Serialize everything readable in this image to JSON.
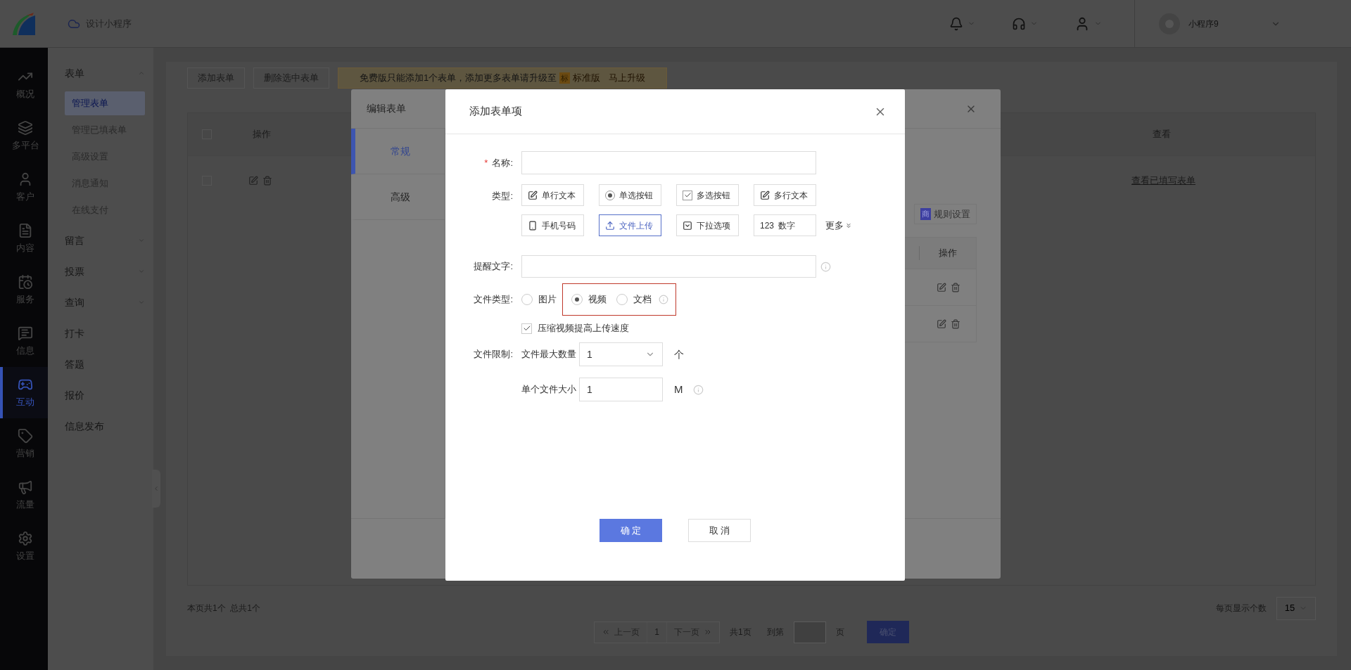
{
  "header": {
    "app_title": "设计小程序",
    "username": "小程序9"
  },
  "rail": [
    {
      "label": "概况",
      "selected": false
    },
    {
      "label": "多平台",
      "selected": false
    },
    {
      "label": "客户",
      "selected": false
    },
    {
      "label": "内容",
      "selected": false
    },
    {
      "label": "服务",
      "selected": false
    },
    {
      "label": "信息",
      "selected": false
    },
    {
      "label": "互动",
      "selected": true
    },
    {
      "label": "营销",
      "selected": false
    },
    {
      "label": "流量",
      "selected": false
    },
    {
      "label": "设置",
      "selected": false
    }
  ],
  "sidebar": [
    {
      "kind": "group",
      "label": "表单",
      "expanded": true,
      "children": [
        {
          "label": "管理表单",
          "selected": true
        },
        {
          "label": "管理已填表单",
          "selected": false
        },
        {
          "label": "高级设置",
          "selected": false
        },
        {
          "label": "消息通知",
          "selected": false
        },
        {
          "label": "在线支付",
          "selected": false
        }
      ]
    },
    {
      "kind": "group",
      "label": "留言",
      "expanded": false
    },
    {
      "kind": "group",
      "label": "投票",
      "expanded": false
    },
    {
      "kind": "group",
      "label": "查询",
      "expanded": false
    },
    {
      "kind": "link",
      "label": "打卡"
    },
    {
      "kind": "link",
      "label": "答题"
    },
    {
      "kind": "link",
      "label": "报价"
    },
    {
      "kind": "link",
      "label": "信息发布"
    }
  ],
  "page": {
    "toolbar": [
      "添加表单",
      "删除选中表单"
    ],
    "banner": {
      "text": "免费版只能添加1个表单，添加更多表单请升级至",
      "badge": "标",
      "edition": "标准版",
      "upgrade": "马上升级"
    },
    "table": {
      "select_all": {
        "checked": false
      },
      "columns": [
        "操作",
        "查看"
      ],
      "rows": [
        {
          "checked": false,
          "link": "查看已填写表单"
        }
      ]
    },
    "summary": "本页共1个  总共1个",
    "pagination": {
      "prev": "上一页",
      "page": "1",
      "next": "下一页",
      "total": "共1页",
      "goto": "到第",
      "unit": "页",
      "confirm": "确定"
    },
    "page_size": {
      "label": "每页显示个数",
      "value": "15"
    }
  },
  "edit_dialog": {
    "title": "编辑表单",
    "tabs": [
      {
        "label": "常规",
        "selected": true
      },
      {
        "label": "高级",
        "selected": false
      }
    ],
    "rule_button": {
      "badge": "商",
      "label": "规则设置"
    },
    "table": {
      "column": "操作",
      "rows": [
        {
          "kind": "edit-delete"
        },
        {
          "kind": "edit-delete"
        }
      ]
    }
  },
  "add_dialog": {
    "title": "添加表单项",
    "name": {
      "label": "名称:",
      "required_mark": "*"
    },
    "type": {
      "label": "类型:",
      "options": [
        {
          "label": "单行文本",
          "selected": false
        },
        {
          "label": "单选按钮",
          "selected": false
        },
        {
          "label": "多选按钮",
          "selected": false
        },
        {
          "label": "多行文本",
          "selected": false
        },
        {
          "label": "手机号码",
          "selected": false
        },
        {
          "label": "文件上传",
          "selected": true
        },
        {
          "label": "下拉选项",
          "selected": false
        },
        {
          "label": "数字",
          "prefix": "123",
          "selected": false
        }
      ],
      "more": "更多"
    },
    "hint": {
      "label": "提醒文字:"
    },
    "file_type": {
      "label": "文件类型:",
      "options": [
        {
          "label": "图片",
          "selected": false,
          "highlighted": false
        },
        {
          "label": "视频",
          "selected": true,
          "highlighted": true
        },
        {
          "label": "文档",
          "selected": false,
          "highlighted": true
        }
      ]
    },
    "compress": {
      "label": "压缩视频提高上传速度",
      "checked": true
    },
    "limit": {
      "label": "文件限制:",
      "max_count": {
        "label": "文件最大数量",
        "value": "1",
        "unit": "个"
      },
      "max_size": {
        "label": "单个文件大小",
        "value": "1",
        "unit": "M"
      }
    },
    "confirm": "确 定",
    "cancel": "取 消"
  }
}
